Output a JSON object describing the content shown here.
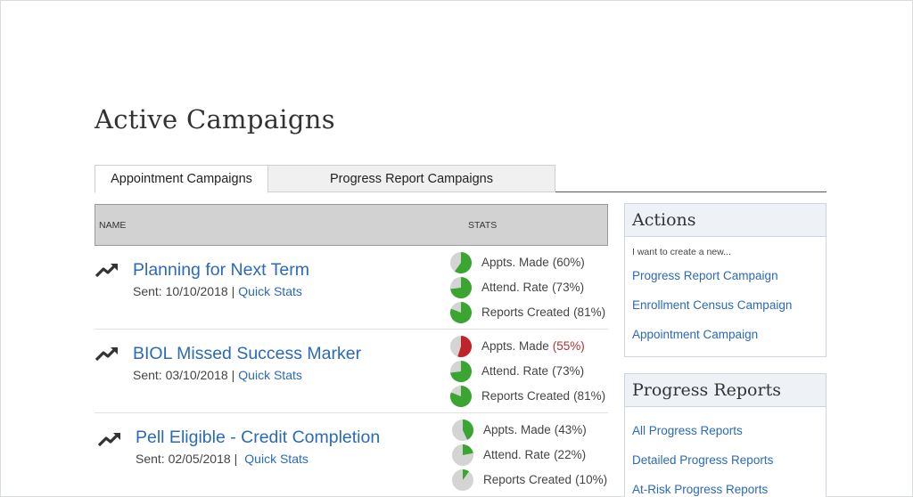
{
  "page": {
    "title": "Active Campaigns"
  },
  "tabs": [
    {
      "label": "Appointment Campaigns",
      "active": true
    },
    {
      "label": "Progress Report Campaigns",
      "active": false
    }
  ],
  "table": {
    "headers": {
      "name": "NAME",
      "stats": "STATS"
    },
    "rows": [
      {
        "name": "Planning for Next Term",
        "sent": "Sent: 10/10/2018",
        "separator": "|",
        "quick_stats": "Quick Stats",
        "stats": [
          {
            "label": "Appts. Made",
            "pct_text": "(60%)",
            "value": 60,
            "color": "#3aa631",
            "warning": false
          },
          {
            "label": "Attend. Rate",
            "pct_text": "(73%)",
            "value": 73,
            "color": "#3aa631",
            "warning": false
          },
          {
            "label": "Reports Created",
            "pct_text": "(81%)",
            "value": 81,
            "color": "#3aa631",
            "warning": false
          }
        ]
      },
      {
        "name": "BIOL Missed Success Marker",
        "sent": "Sent: 03/10/2018",
        "separator": "|",
        "quick_stats": "Quick Stats",
        "stats": [
          {
            "label": "Appts. Made",
            "pct_text": "(55%)",
            "value": 55,
            "color": "#c0232a",
            "warning": true
          },
          {
            "label": "Attend. Rate",
            "pct_text": "(73%)",
            "value": 73,
            "color": "#3aa631",
            "warning": false
          },
          {
            "label": "Reports Created",
            "pct_text": "(81%)",
            "value": 81,
            "color": "#3aa631",
            "warning": false
          }
        ]
      },
      {
        "name": "Pell Eligible - Credit Completion",
        "sent": "Sent: 02/05/2018",
        "separator": "|",
        "quick_stats": "Quick Stats",
        "stats": [
          {
            "label": "Appts. Made",
            "pct_text": "(43%)",
            "value": 43,
            "color": "#3aa631",
            "warning": false
          },
          {
            "label": "Attend. Rate",
            "pct_text": "(22%)",
            "value": 22,
            "color": "#3aa631",
            "warning": false
          },
          {
            "label": "Reports Created",
            "pct_text": "(10%)",
            "value": 10,
            "color": "#3aa631",
            "warning": false
          }
        ]
      }
    ]
  },
  "actions": {
    "title": "Actions",
    "subtitle": "I want to create a new...",
    "links": [
      "Progress Report Campaign",
      "Enrollment Census Campaign",
      "Appointment Campaign"
    ]
  },
  "progress_reports": {
    "title": "Progress Reports",
    "links": [
      "All Progress Reports",
      "Detailed Progress Reports",
      "At-Risk Progress Reports"
    ]
  },
  "colors": {
    "link": "#2a6ab8",
    "success": "#3aa631",
    "warning": "#c0232a",
    "pie_track": "#d4d4d4"
  }
}
